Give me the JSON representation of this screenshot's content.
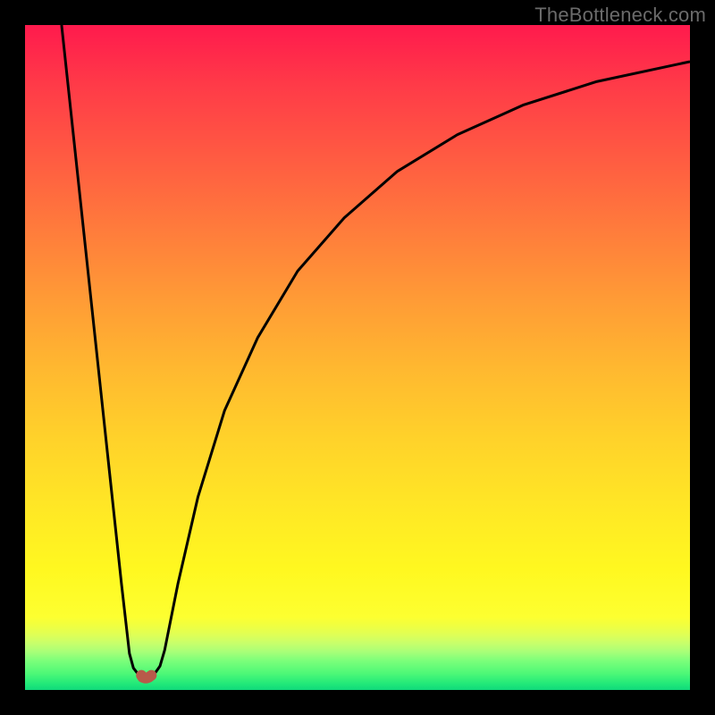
{
  "watermark": {
    "text": "TheBottleneck.com"
  },
  "chart_data": {
    "type": "line",
    "title": "",
    "xlabel": "",
    "ylabel": "",
    "xlim": [
      0,
      100
    ],
    "ylim": [
      0,
      100
    ],
    "grid": false,
    "legend": false,
    "series": [
      {
        "name": "left-branch",
        "x": [
          5.5,
          7,
          8.5,
          10,
          11.5,
          13,
          14.5,
          15.7,
          16.3,
          17.0,
          17.5
        ],
        "y": [
          100,
          86,
          72,
          58,
          44,
          30,
          16,
          5.5,
          3.3,
          2.4,
          2.2
        ]
      },
      {
        "name": "right-branch",
        "x": [
          19.0,
          19.6,
          20.3,
          21,
          23,
          26,
          30,
          35,
          41,
          48,
          56,
          65,
          75,
          86,
          100
        ],
        "y": [
          2.2,
          2.6,
          3.6,
          6,
          16,
          29,
          42,
          53,
          63,
          71,
          78,
          83.5,
          88,
          91.5,
          94.5
        ]
      },
      {
        "name": "bottom-connector",
        "x": [
          17.5,
          17.7,
          18.0,
          18.3,
          18.6,
          19.0
        ],
        "y": [
          2.2,
          1.9,
          1.8,
          1.8,
          1.9,
          2.2
        ]
      }
    ],
    "colors": {
      "curve": "#000000",
      "connector": "#b85a4a",
      "gradient_top": "#ff1a4d",
      "gradient_mid": "#ffe825",
      "gradient_bottom": "#10d87a"
    },
    "annotations": []
  }
}
